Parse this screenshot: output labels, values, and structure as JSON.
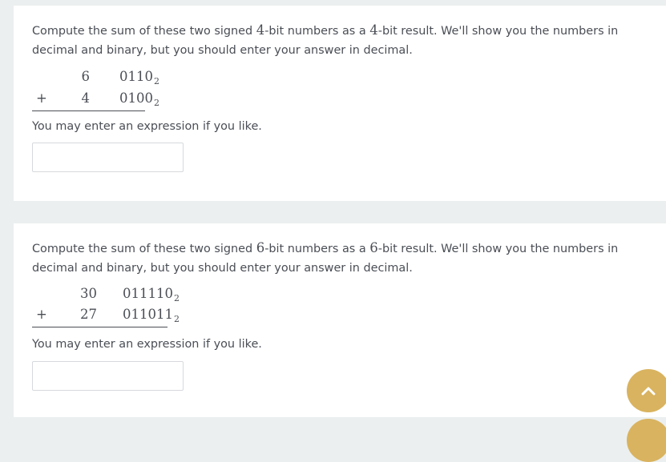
{
  "problems": [
    {
      "bits": "4",
      "prompt_pre": "Compute the sum of these two signed ",
      "prompt_mid": "-bit  numbers as a ",
      "prompt_post": "-bit result. We'll show you the numbers in decimal and binary, but you should enter your answer in decimal.",
      "operator": "+",
      "operand1_decimal": "6",
      "operand1_binary": "0110",
      "operand2_decimal": "4",
      "operand2_binary": "0100",
      "base": "2",
      "hint": "You may enter an expression if you like.",
      "answer_value": ""
    },
    {
      "bits": "6",
      "prompt_pre": "Compute the sum of these two signed ",
      "prompt_mid": "-bit  numbers as a ",
      "prompt_post": "-bit result. We'll show you the numbers in decimal and binary, but you should enter your answer in decimal.",
      "operator": "+",
      "operand1_decimal": "30",
      "operand1_binary": "011110",
      "operand2_decimal": "27",
      "operand2_binary": "011011",
      "base": "2",
      "hint": "You may enter an expression if you like.",
      "answer_value": ""
    }
  ],
  "scroll_top": {
    "icon": "chevron-up-icon",
    "color": "#d9b35f"
  }
}
